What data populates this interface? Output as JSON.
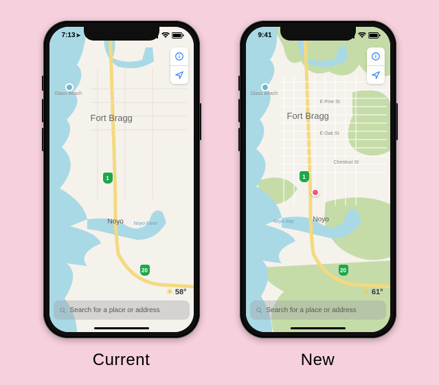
{
  "phones": {
    "current": {
      "status": {
        "time": "7:13"
      },
      "city_label": "Fort Bragg",
      "noyo_label": "Noyo",
      "noyo_river_label": "Noyo River",
      "beach_label": "Glass Beach",
      "highway_1": "1",
      "highway_20": "20",
      "weather": "58°",
      "search_placeholder": "Search for a place or address",
      "caption": "Current"
    },
    "new": {
      "status": {
        "time": "9:41"
      },
      "city_label": "Fort Bragg",
      "noyo_label": "Noyo",
      "noyo_bay_label": "Noyo Bay",
      "beach_label": "Glass Beach",
      "pine_st_label": "E Pine St",
      "oak_st_label": "E Oak St",
      "chestnut_st_label": "Chestnut St",
      "highway_1": "1",
      "highway_20": "20",
      "weather": "61°",
      "search_placeholder": "Search for a place or address",
      "caption": "New"
    }
  }
}
